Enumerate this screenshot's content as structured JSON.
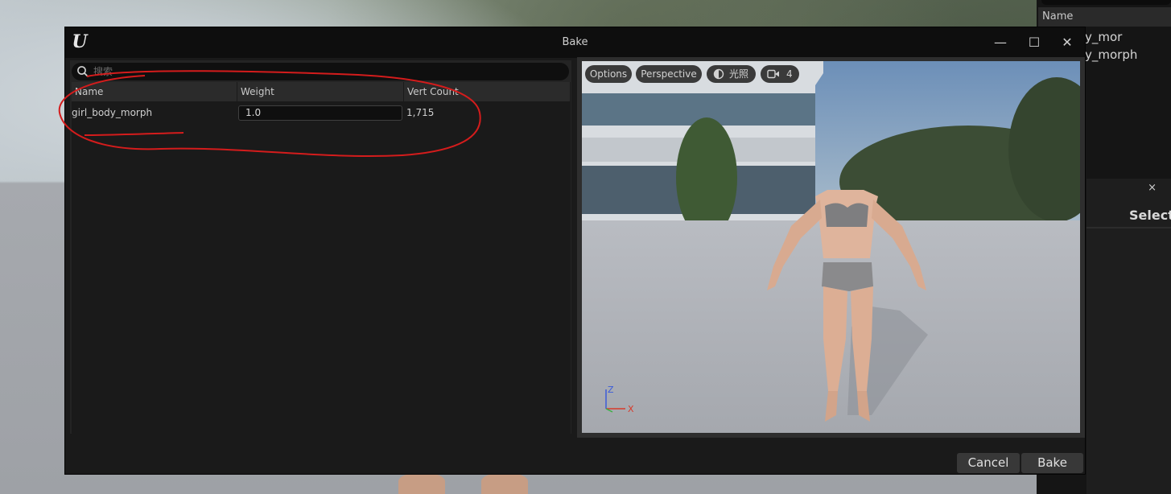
{
  "dialog": {
    "title": "Bake",
    "window_controls": {
      "minimize": "—",
      "maximize": "☐",
      "close": "✕"
    }
  },
  "search": {
    "placeholder": "搜索",
    "value": ""
  },
  "table": {
    "columns": [
      "Name",
      "Weight",
      "Vert Count"
    ],
    "rows": [
      {
        "name": "girl_body_morph",
        "weight": "1.0",
        "vert_count": "1,715"
      }
    ]
  },
  "viewport": {
    "toolbar": {
      "options": "Options",
      "perspective": "Perspective",
      "lighting": "光照",
      "camera_speed": "4"
    },
    "axis": {
      "z": "Z",
      "x": "X"
    }
  },
  "footer": {
    "cancel": "Cancel",
    "bake": "Bake"
  },
  "background_panel": {
    "column_header": "Name",
    "items": [
      "y_mor",
      "y_morph"
    ],
    "sub_panel_title": "Select a",
    "sub_panel_close": "×"
  },
  "colors": {
    "annotation_red": "#d41c1c",
    "axis_z": "#3a5bd9",
    "axis_x": "#d83a2a",
    "axis_y": "#3cb043"
  }
}
